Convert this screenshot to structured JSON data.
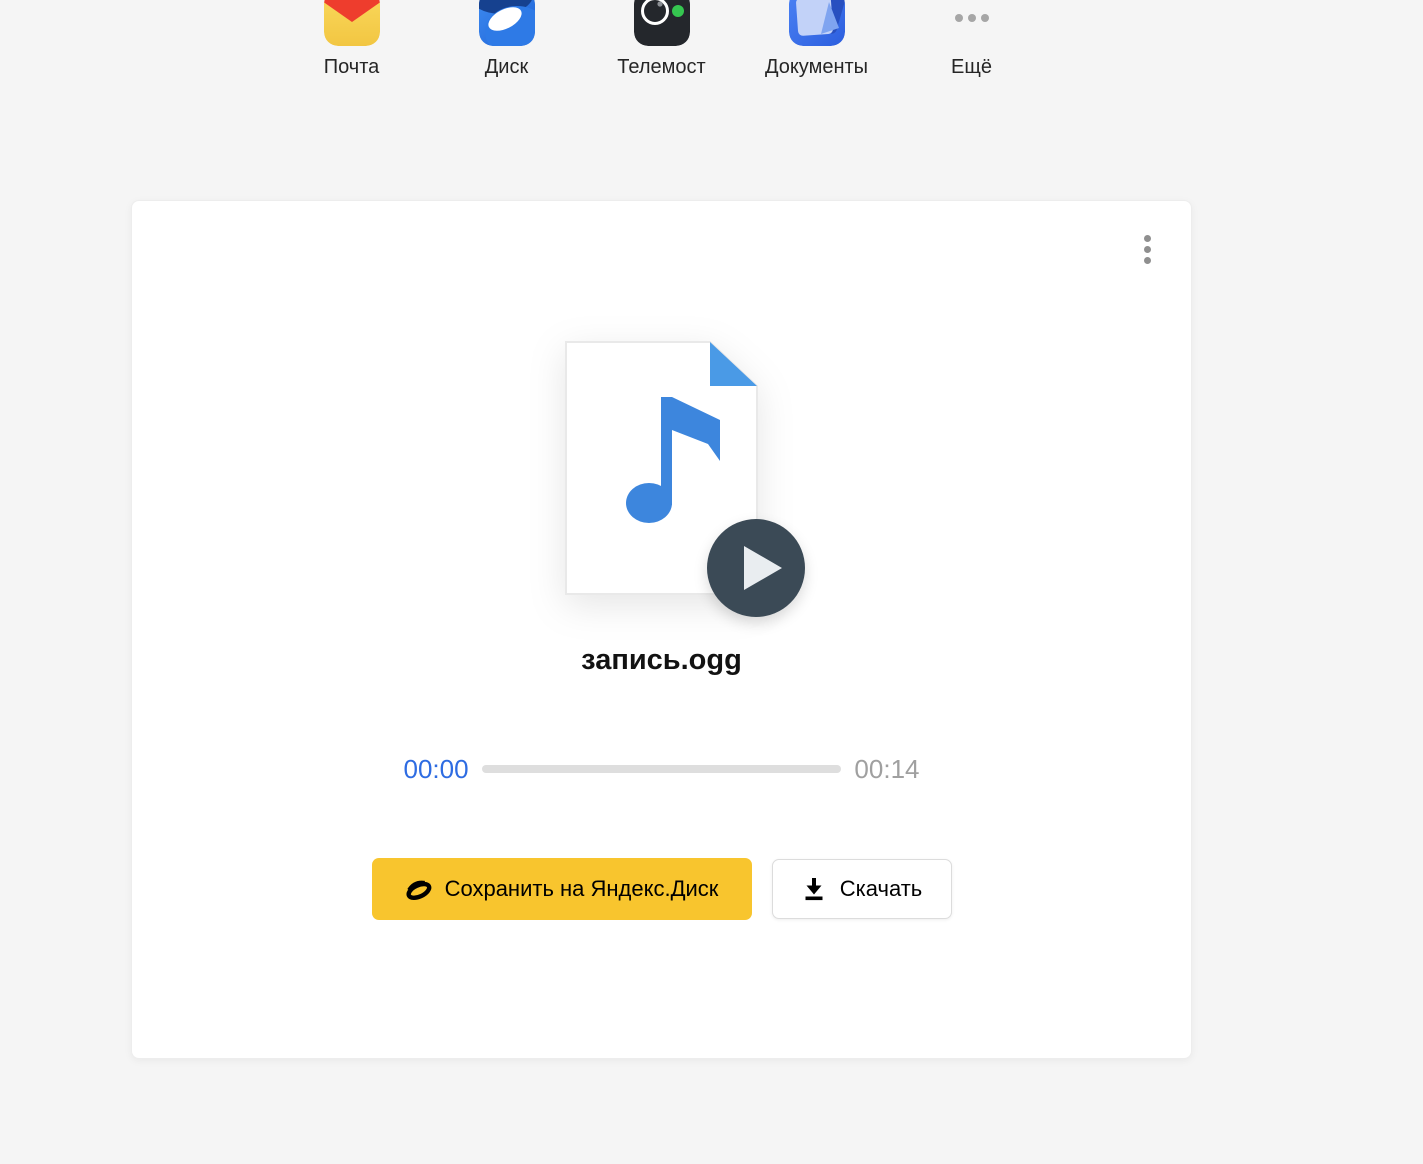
{
  "app_bar": {
    "items": [
      {
        "label": "Почта",
        "icon": "mail-icon"
      },
      {
        "label": "Диск",
        "icon": "disk-icon"
      },
      {
        "label": "Телемост",
        "icon": "telemost-icon"
      },
      {
        "label": "Документы",
        "icon": "documents-icon"
      },
      {
        "label": "Ещё",
        "icon": "more-dots-icon"
      }
    ]
  },
  "card": {
    "file": {
      "name": "запись.ogg",
      "type_icon": "audio-file-icon"
    },
    "player": {
      "current_time": "00:00",
      "total_time": "00:14",
      "progress_percent": 0
    },
    "buttons": {
      "save_label": "Сохранить на Яндекс.Диск",
      "download_label": "Скачать"
    }
  },
  "colors": {
    "accent_yellow": "#f8c52e",
    "time_blue": "#2e6ce2",
    "play_circle": "#3b4a56",
    "note_blue": "#3d86dd",
    "fold_blue": "#4a9ae6",
    "background": "#f5f5f5"
  }
}
